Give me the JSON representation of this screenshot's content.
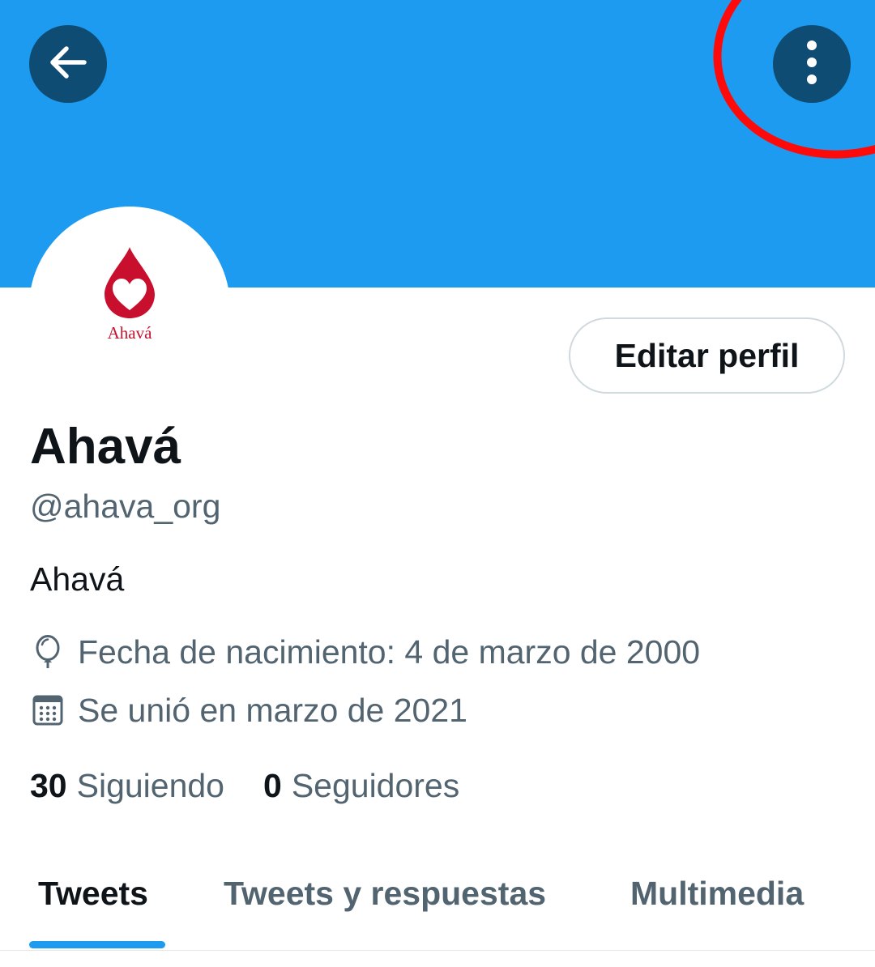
{
  "header": {
    "back_icon": "arrow-left-icon",
    "more_icon": "more-vertical-icon",
    "banner_color": "#1d9bf0",
    "button_color": "#0f4c73",
    "highlight_color": "#ff0a0a"
  },
  "profile": {
    "avatar_logo_text": "Ahavá",
    "edit_button_label": "Editar perfil",
    "display_name": "Ahavá",
    "handle": "@ahava_org",
    "bio": "Ahavá",
    "birthdate": "Fecha de nacimiento: 4 de marzo de 2000",
    "birthdate_icon": "balloon-icon",
    "joined": "Se unió en marzo de 2021",
    "joined_icon": "calendar-icon",
    "brand_color": "#c8102e"
  },
  "stats": {
    "following_count": "30",
    "following_label": "Siguiendo",
    "followers_count": "0",
    "followers_label": "Seguidores"
  },
  "tabs": [
    {
      "label": "Tweets",
      "active": true
    },
    {
      "label": "Tweets y respuestas",
      "active": false
    },
    {
      "label": "Multimedia",
      "active": false
    }
  ],
  "accent_color": "#1d9bf0"
}
